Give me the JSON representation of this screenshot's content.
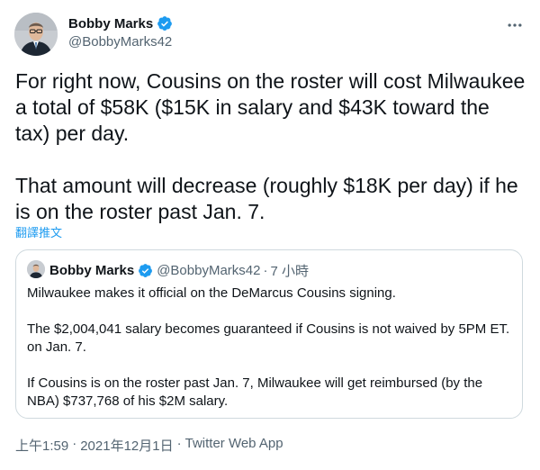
{
  "author": {
    "name": "Bobby Marks",
    "handle": "@BobbyMarks42",
    "verified": true
  },
  "tweet": {
    "paragraphs": [
      "For right now, Cousins on the roster will cost Milwaukee a total of $58K ($15K in salary and $43K toward the tax) per day.",
      "That amount will decrease (roughly $18K per day) if he is on the roster past Jan. 7."
    ],
    "translate_label": "翻譯推文"
  },
  "quoted_tweet": {
    "name": "Bobby Marks",
    "handle": "@BobbyMarks42",
    "separator": "·",
    "time": "7 小時",
    "paragraphs": [
      "Milwaukee makes it official on the DeMarcus Cousins signing.",
      "The $2,004,041 salary becomes guaranteed if Cousins is not waived by 5PM ET. on Jan. 7.",
      "If Cousins is on the roster past Jan. 7, Milwaukee will get reimbursed (by the NBA) $737,768 of his $2M salary."
    ]
  },
  "meta": {
    "time": "上午1:59",
    "separator": "·",
    "date": "2021年12月1日",
    "source": "Twitter Web App"
  },
  "icons": {
    "verified": "verified-badge-icon",
    "more": "more-options-icon"
  },
  "colors": {
    "accent": "#1d9bf0",
    "text": "#0f1419",
    "secondary_text": "#536471",
    "border": "#cfd9de"
  }
}
